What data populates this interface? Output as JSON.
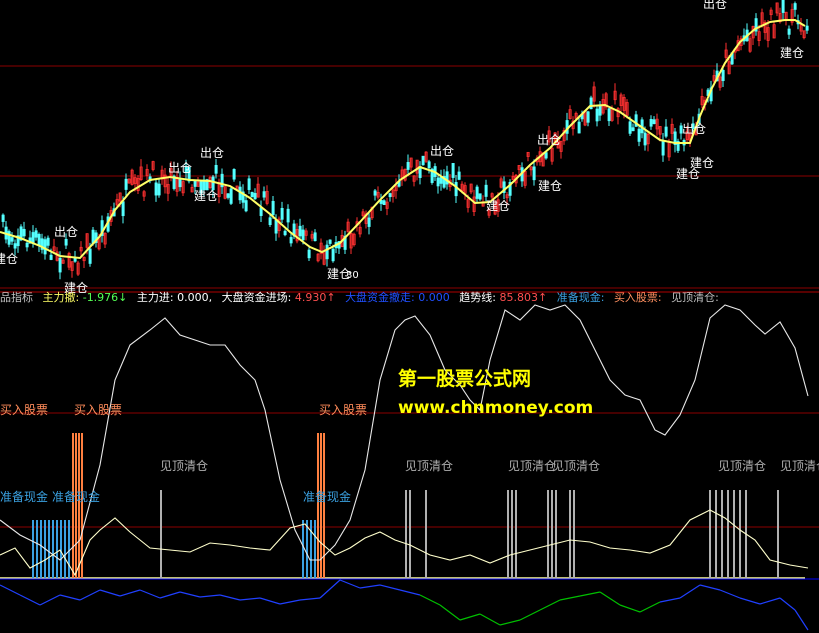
{
  "colors": {
    "background": "#000000",
    "up_candle": "#ff3030",
    "down_candle": "#54ffff",
    "ma_line": "#ffff66",
    "grid": "#8b0000",
    "trend_line": "#e8e8e8",
    "main_inflow_line": "#ffffcc",
    "market_fund_up": "#00c000",
    "market_fund_down": "#2040ff",
    "baseline": "#ffff99",
    "blue_baseline": "#0000ff",
    "buy_bars": "#ff8040",
    "cash_bars": "#3aa0e0",
    "top_bars": "#b0b0b0"
  },
  "legend": {
    "name": "品指标",
    "main_exit_label": "主力撤:",
    "main_exit_value": "-1.976↓",
    "main_in_label": "主力进:",
    "main_in_value": "0.000,",
    "market_in_label": "大盘资金进场:",
    "market_in_value": "4.930↑",
    "market_out_label": "大盘资金撤走:",
    "market_out_value": "0.000",
    "trend_label": "趋势线:",
    "trend_value": "85.803↑",
    "cash_label": "准备现金:",
    "buy_label": "买入股票:",
    "top_label": "见顶清仓:"
  },
  "watermark": {
    "line1": "第一股票公式网",
    "line2": "www.chnmoney.com"
  },
  "labels": {
    "out": "出仓",
    "in": "建仓",
    "buy": "买入股票",
    "cash": "准备现金",
    "top": "见顶清仓",
    "low_value": "30"
  },
  "chart_data": [
    {
      "type": "candlestick",
      "title": "",
      "description_free": true,
      "ma_series": {
        "name": "",
        "points": [
          [
            0,
            232
          ],
          [
            20,
            238
          ],
          [
            40,
            246
          ],
          [
            60,
            256
          ],
          [
            80,
            258
          ],
          [
            100,
            236
          ],
          [
            115,
            210
          ],
          [
            130,
            192
          ],
          [
            150,
            180
          ],
          [
            170,
            177
          ],
          [
            190,
            180
          ],
          [
            210,
            181
          ],
          [
            230,
            186
          ],
          [
            250,
            198
          ],
          [
            270,
            214
          ],
          [
            290,
            232
          ],
          [
            310,
            247
          ],
          [
            322,
            252
          ],
          [
            340,
            243
          ],
          [
            360,
            222
          ],
          [
            380,
            200
          ],
          [
            400,
            180
          ],
          [
            420,
            167
          ],
          [
            435,
            172
          ],
          [
            455,
            186
          ],
          [
            475,
            203
          ],
          [
            490,
            202
          ],
          [
            510,
            185
          ],
          [
            530,
            165
          ],
          [
            550,
            148
          ],
          [
            570,
            126
          ],
          [
            590,
            106
          ],
          [
            605,
            105
          ],
          [
            620,
            112
          ],
          [
            640,
            126
          ],
          [
            660,
            140
          ],
          [
            675,
            143
          ],
          [
            690,
            143
          ],
          [
            700,
            116
          ],
          [
            712,
            88
          ],
          [
            725,
            63
          ],
          [
            740,
            42
          ],
          [
            755,
            29
          ],
          [
            770,
            22
          ],
          [
            785,
            20
          ],
          [
            795,
            20
          ],
          [
            805,
            26
          ]
        ]
      },
      "signals_out": [
        [
          66,
          236
        ],
        [
          180,
          172
        ],
        [
          212,
          157
        ],
        [
          442,
          155
        ],
        [
          549,
          144
        ],
        [
          694,
          133
        ],
        [
          715,
          8
        ]
      ],
      "signals_in": [
        [
          6,
          263
        ],
        [
          76,
          292
        ],
        [
          206,
          200
        ],
        [
          339,
          278
        ],
        [
          498,
          210
        ],
        [
          550,
          190
        ],
        [
          688,
          178
        ],
        [
          702,
          167
        ],
        [
          792,
          57
        ]
      ]
    },
    {
      "type": "line",
      "title": "",
      "series": [
        {
          "name": "趋势线",
          "color_key": "trend_line",
          "points": [
            [
              0,
              520
            ],
            [
              20,
              535
            ],
            [
              40,
              545
            ],
            [
              60,
              560
            ],
            [
              80,
              540
            ],
            [
              100,
              465
            ],
            [
              115,
              380
            ],
            [
              130,
              345
            ],
            [
              150,
              330
            ],
            [
              165,
              318
            ],
            [
              180,
              335
            ],
            [
              195,
              340
            ],
            [
              210,
              345
            ],
            [
              225,
              345
            ],
            [
              240,
              365
            ],
            [
              255,
              380
            ],
            [
              265,
              410
            ],
            [
              280,
              480
            ],
            [
              295,
              530
            ],
            [
              310,
              560
            ],
            [
              320,
              560
            ],
            [
              335,
              545
            ],
            [
              350,
              520
            ],
            [
              365,
              470
            ],
            [
              380,
              380
            ],
            [
              395,
              330
            ],
            [
              405,
              320
            ],
            [
              415,
              316
            ],
            [
              430,
              335
            ],
            [
              445,
              370
            ],
            [
              460,
              385
            ],
            [
              470,
              400
            ],
            [
              480,
              410
            ],
            [
              490,
              360
            ],
            [
              505,
              310
            ],
            [
              520,
              320
            ],
            [
              535,
              305
            ],
            [
              550,
              310
            ],
            [
              565,
              305
            ],
            [
              580,
              320
            ],
            [
              595,
              350
            ],
            [
              610,
              380
            ],
            [
              625,
              395
            ],
            [
              640,
              400
            ],
            [
              655,
              430
            ],
            [
              665,
              435
            ],
            [
              680,
              415
            ],
            [
              695,
              380
            ],
            [
              710,
              318
            ],
            [
              725,
              305
            ],
            [
              740,
              310
            ],
            [
              755,
              325
            ],
            [
              765,
              334
            ],
            [
              780,
              322
            ],
            [
              795,
              348
            ],
            [
              808,
              396
            ]
          ]
        },
        {
          "name": "主力进",
          "color_key": "main_inflow_line",
          "points": [
            [
              0,
              555
            ],
            [
              15,
              548
            ],
            [
              30,
              568
            ],
            [
              45,
              560
            ],
            [
              60,
              550
            ],
            [
              75,
              575
            ],
            [
              90,
              540
            ],
            [
              100,
              530
            ],
            [
              115,
              518
            ],
            [
              130,
              532
            ],
            [
              150,
              548
            ],
            [
              170,
              550
            ],
            [
              190,
              552
            ],
            [
              210,
              543
            ],
            [
              230,
              545
            ],
            [
              250,
              548
            ],
            [
              270,
              550
            ],
            [
              290,
              528
            ],
            [
              305,
              524
            ],
            [
              320,
              542
            ],
            [
              335,
              555
            ],
            [
              350,
              548
            ],
            [
              365,
              538
            ],
            [
              380,
              532
            ],
            [
              395,
              540
            ],
            [
              410,
              545
            ],
            [
              430,
              555
            ],
            [
              450,
              560
            ],
            [
              470,
              555
            ],
            [
              490,
              563
            ],
            [
              510,
              555
            ],
            [
              530,
              550
            ],
            [
              550,
              545
            ],
            [
              570,
              540
            ],
            [
              590,
              542
            ],
            [
              610,
              548
            ],
            [
              630,
              550
            ],
            [
              650,
              553
            ],
            [
              670,
              545
            ],
            [
              690,
              520
            ],
            [
              710,
              510
            ],
            [
              725,
              518
            ],
            [
              740,
              530
            ],
            [
              755,
              540
            ],
            [
              770,
              560
            ],
            [
              790,
              565
            ],
            [
              808,
              568
            ]
          ]
        },
        {
          "name": "大盘资金",
          "color_key": "market_fund_down",
          "points": [
            [
              0,
              585
            ],
            [
              20,
              595
            ],
            [
              40,
              605
            ],
            [
              60,
              595
            ],
            [
              80,
              600
            ],
            [
              100,
              590
            ],
            [
              120,
              596
            ],
            [
              140,
              590
            ],
            [
              160,
              598
            ],
            [
              180,
              592
            ],
            [
              200,
              597
            ],
            [
              220,
              595
            ],
            [
              240,
              600
            ],
            [
              260,
              598
            ],
            [
              280,
              604
            ],
            [
              300,
              600
            ],
            [
              320,
              598
            ],
            [
              340,
              580
            ],
            [
              360,
              588
            ],
            [
              380,
              585
            ],
            [
              400,
              590
            ],
            [
              420,
              595
            ],
            [
              440,
              605
            ],
            [
              460,
              620
            ],
            [
              480,
              614
            ],
            [
              500,
              625
            ],
            [
              520,
              620
            ],
            [
              540,
              610
            ],
            [
              560,
              600
            ],
            [
              580,
              596
            ],
            [
              600,
              592
            ],
            [
              620,
              605
            ],
            [
              640,
              612
            ],
            [
              660,
              602
            ],
            [
              680,
              598
            ],
            [
              700,
              585
            ],
            [
              720,
              590
            ],
            [
              740,
              598
            ],
            [
              760,
              604
            ],
            [
              780,
              598
            ],
            [
              795,
              610
            ],
            [
              808,
              630
            ]
          ]
        }
      ],
      "bars_buy_x": [
        73,
        76,
        79,
        82,
        318,
        321,
        324
      ],
      "bars_cash_x": [
        33,
        37,
        41,
        45,
        49,
        53,
        57,
        61,
        65,
        69,
        303,
        307,
        311,
        315
      ],
      "bars_top_x": [
        161,
        406,
        410,
        426,
        508,
        512,
        516,
        548,
        552,
        556,
        570,
        574,
        710,
        716,
        722,
        728,
        734,
        740,
        746,
        778
      ],
      "text_buy": [
        [
          0,
          410
        ],
        [
          74,
          410
        ],
        [
          319,
          410
        ]
      ],
      "text_cash": [
        [
          0,
          497
        ],
        [
          52,
          497
        ],
        [
          303,
          497
        ]
      ],
      "text_top": [
        [
          160,
          466
        ],
        [
          405,
          466
        ],
        [
          508,
          466
        ],
        [
          552,
          466
        ],
        [
          718,
          466
        ],
        [
          780,
          466
        ]
      ]
    }
  ]
}
